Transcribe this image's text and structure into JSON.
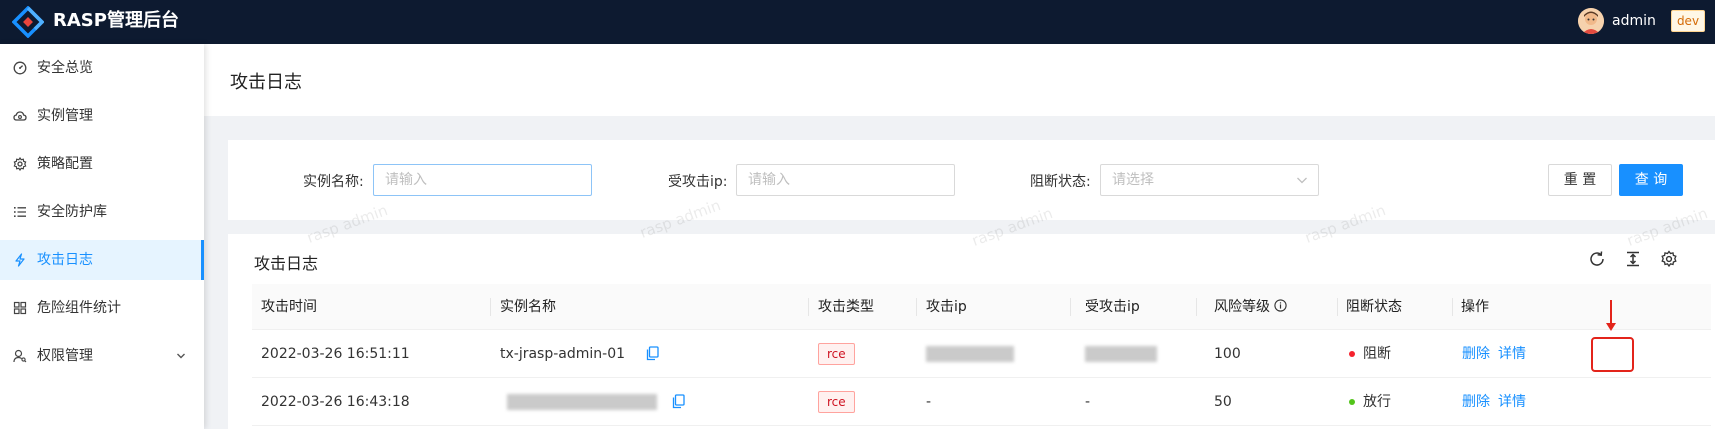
{
  "header": {
    "app_title": "RASP管理后台",
    "username": "admin",
    "env_tag": "dev"
  },
  "sidebar": {
    "items": [
      {
        "label": "安全总览",
        "icon": "dashboard-icon"
      },
      {
        "label": "实例管理",
        "icon": "cloud-icon"
      },
      {
        "label": "策略配置",
        "icon": "gear-icon"
      },
      {
        "label": "安全防护库",
        "icon": "list-icon"
      },
      {
        "label": "攻击日志",
        "icon": "lightning-icon",
        "active": true
      },
      {
        "label": "危险组件统计",
        "icon": "grid-icon"
      },
      {
        "label": "权限管理",
        "icon": "user-key-icon",
        "expandable": true
      }
    ]
  },
  "page": {
    "title": "攻击日志"
  },
  "search": {
    "instance_label": "实例名称:",
    "instance_placeholder": "请输入",
    "target_ip_label": "受攻击ip:",
    "target_ip_placeholder": "请输入",
    "block_status_label": "阻断状态:",
    "block_status_placeholder": "请选择",
    "reset_label": "重 置",
    "query_label": "查 询"
  },
  "table": {
    "title": "攻击日志",
    "columns": [
      "攻击时间",
      "实例名称",
      "攻击类型",
      "攻击ip",
      "受攻击ip",
      "风险等级",
      "阻断状态",
      "操作"
    ],
    "rows": [
      {
        "time": "2022-03-26 16:51:11",
        "instance": "tx-jrasp-admin-01",
        "type": "rce",
        "attack_ip": "",
        "target_ip": "",
        "risk": "100",
        "status": "阻断",
        "status_color": "#f5222d",
        "action_delete": "删除",
        "action_detail": "详情"
      },
      {
        "time": "2022-03-26 16:43:18",
        "instance": "",
        "type": "rce",
        "attack_ip": "-",
        "target_ip": "-",
        "risk": "50",
        "status": "放行",
        "status_color": "#52c41a",
        "action_delete": "删除",
        "action_detail": "详情"
      }
    ]
  },
  "watermark": "rasp admin",
  "colors": {
    "primary": "#1890ff",
    "header_bg": "#0d1a30",
    "danger": "#f5222d",
    "success": "#52c41a"
  }
}
